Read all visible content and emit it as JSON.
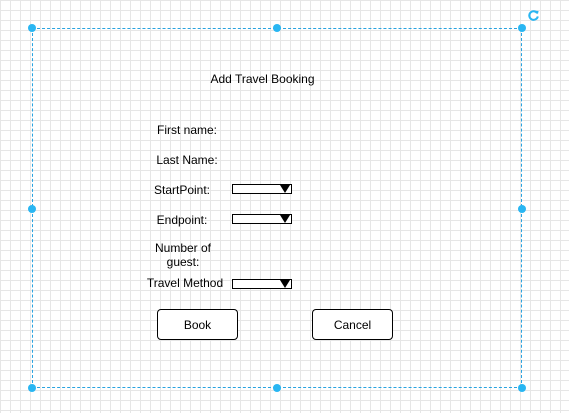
{
  "form": {
    "title": "Add Travel Booking",
    "fields": {
      "first_name": "First name:",
      "last_name": "Last Name:",
      "start_point": "StartPoint:",
      "endpoint": "Endpoint:",
      "guests": "Number of guest:",
      "travel_method": "Travel Method"
    },
    "buttons": {
      "book": "Book",
      "cancel": "Cancel"
    }
  },
  "icons": {
    "rotate": "rotate-icon",
    "dropdown_arrow": "dropdown-arrow-icon"
  },
  "colors": {
    "selection": "#29a3e0",
    "handle": "#29b6f2",
    "grid": "#e6e6e6"
  }
}
